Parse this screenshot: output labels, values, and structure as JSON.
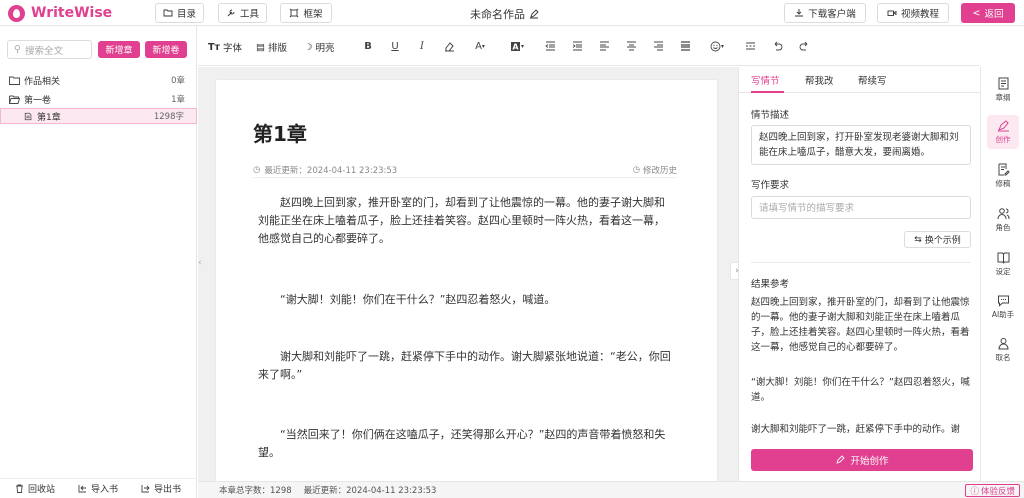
{
  "app": {
    "name": "WriteWise",
    "doc_title": "未命名作品"
  },
  "topbar": {
    "catalog": "目录",
    "tools": "工具",
    "frame": "框架",
    "download": "下载客户端",
    "video": "视频教程",
    "back": "返回"
  },
  "sidebar": {
    "search_placeholder": "搜索全文",
    "new_chapter": "新增章",
    "new_volume": "新增卷",
    "items": [
      {
        "label": "作品相关",
        "count": "0章"
      },
      {
        "label": "第一卷",
        "count": "1章"
      },
      {
        "label": "第1章",
        "count": "1298字"
      }
    ],
    "bottom": {
      "recycle": "回收站",
      "import": "导入书",
      "export": "导出书"
    }
  },
  "toolbar": {
    "font": "字体",
    "layout": "排版",
    "bright": "明亮"
  },
  "editor": {
    "chapter_title": "第1章",
    "last_updated": "最近更新：2024-04-11 23:23:53",
    "history": "修改历史",
    "paragraphs": [
      "赵四晚上回到家，推开卧室的门，却看到了让他震惊的一幕。他的妻子谢大脚和刘能正坐在床上嗑着瓜子，脸上还挂着笑容。赵四心里顿时一阵火热，看着这一幕，他感觉自己的心都要碎了。",
      "“谢大脚！刘能！你们在干什么？”赵四忍着怒火，喊道。",
      "谢大脚和刘能吓了一跳，赶紧停下手中的动作。谢大脚紧张地说道：“老公，你回来了啊。”",
      "“当然回来了！你们俩在这嗑瓜子，还笑得那么开心？”赵四的声音带着愤怒和失望。"
    ]
  },
  "status": {
    "word_count": "本章总字数：1298",
    "last_updated": "最近更新：2024-04-11 23:23:53",
    "feedback": "体验反馈"
  },
  "panel": {
    "tabs": [
      "写情节",
      "帮我改",
      "帮续写"
    ],
    "plot_label": "情节描述",
    "plot_value": "赵四晚上回到家，打开卧室发现老婆谢大脚和刘能在床上嗑瓜子，醋意大发，要闹离婚。",
    "req_label": "写作要求",
    "req_placeholder": "请填写情节的描写要求",
    "swap": "换个示例",
    "result_label": "结果参考",
    "result_paras": [
      "赵四晚上回到家，推开卧室的门，却看到了让他震惊的一幕。他的妻子谢大脚和刘能正坐在床上嗑着瓜子，脸上还挂着笑容。赵四心里顿时一阵火热，看着这一幕，他感觉自己的心都要碎了。",
      "“谢大脚！刘能！你们在干什么？”赵四忍着怒火，喊道。",
      "谢大脚和刘能吓了一跳，赶紧停下手中的动作。谢"
    ],
    "start": "开始创作"
  },
  "rnav": [
    "章纲",
    "创作",
    "修稿",
    "角色",
    "设定",
    "AI助手",
    "取名"
  ],
  "colors": {
    "accent": "#e0408f"
  }
}
